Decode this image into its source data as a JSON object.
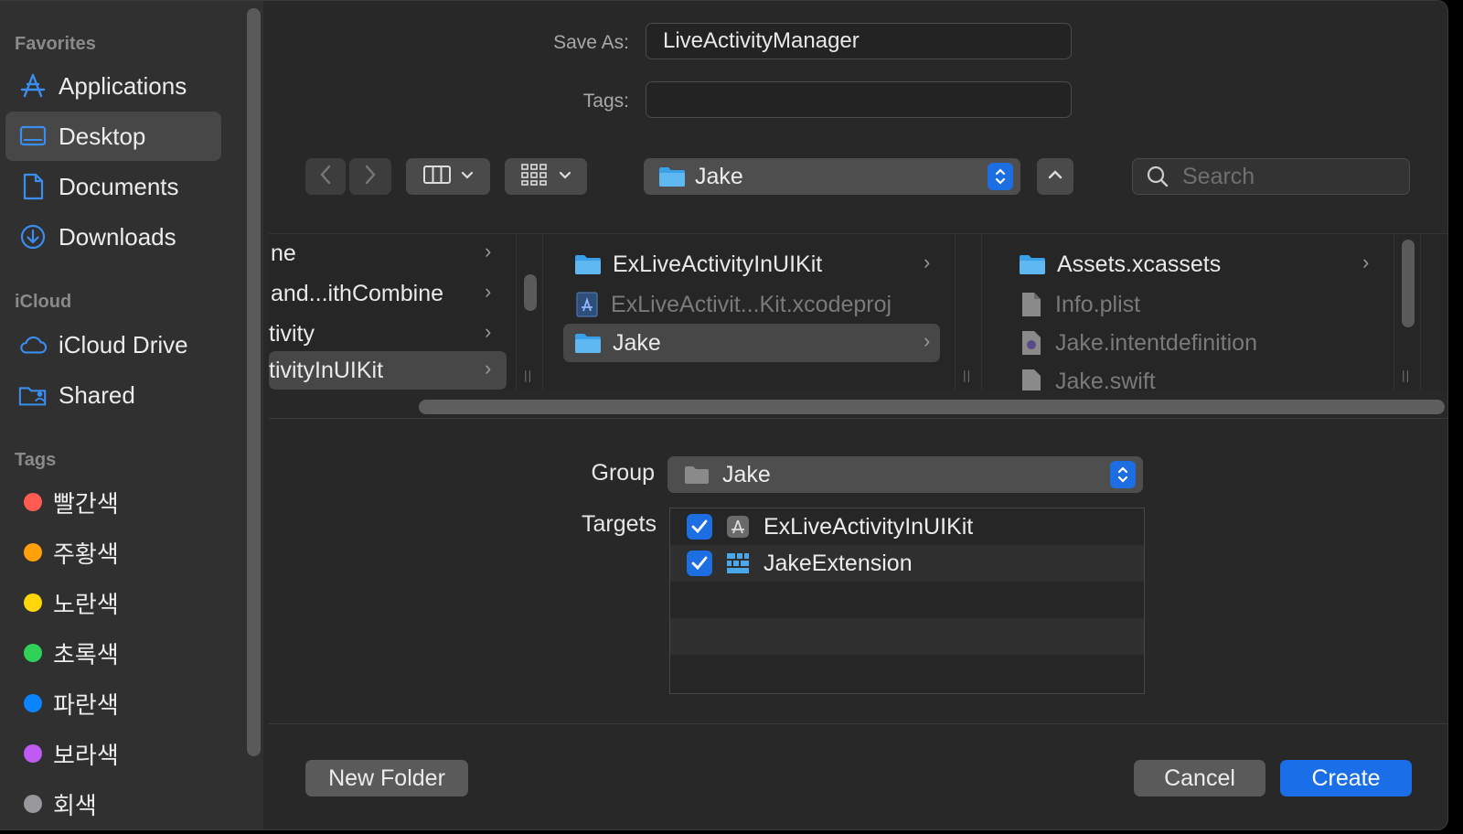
{
  "sidebar": {
    "sections": {
      "favorites": "Favorites",
      "icloud": "iCloud",
      "tags": "Tags"
    },
    "favorites": [
      {
        "label": "Applications",
        "icon": "applications-icon"
      },
      {
        "label": "Desktop",
        "icon": "desktop-icon",
        "selected": true
      },
      {
        "label": "Documents",
        "icon": "document-icon"
      },
      {
        "label": "Downloads",
        "icon": "download-icon"
      }
    ],
    "icloud": [
      {
        "label": "iCloud Drive",
        "icon": "cloud-icon"
      },
      {
        "label": "Shared",
        "icon": "shared-folder-icon"
      }
    ],
    "tags": [
      {
        "label": "빨간색",
        "color": "#ff5b52"
      },
      {
        "label": "주황색",
        "color": "#ff9f0a"
      },
      {
        "label": "노란색",
        "color": "#ffd60a"
      },
      {
        "label": "초록색",
        "color": "#30d158"
      },
      {
        "label": "파란색",
        "color": "#0a84ff"
      },
      {
        "label": "보라색",
        "color": "#bf5af2"
      },
      {
        "label": "회색",
        "color": "#98989d"
      }
    ]
  },
  "form": {
    "save_as_label": "Save As:",
    "save_as_value": "LiveActivityManager",
    "tags_label": "Tags:",
    "tags_value": ""
  },
  "toolbar": {
    "location": "Jake",
    "search_placeholder": "Search"
  },
  "browser": {
    "column1": [
      {
        "label": "ne"
      },
      {
        "label": "and...ithCombine"
      },
      {
        "label": "tivity"
      },
      {
        "label": "tivityInUIKit",
        "selected": true
      }
    ],
    "column2": [
      {
        "label": "ExLiveActivityInUIKit",
        "type": "folder"
      },
      {
        "label": "ExLiveActivit...Kit.xcodeproj",
        "type": "xcodeproj"
      },
      {
        "label": "Jake",
        "type": "folder",
        "selected": true
      }
    ],
    "column3": [
      {
        "label": "Assets.xcassets",
        "type": "folder"
      },
      {
        "label": "Info.plist",
        "type": "plist"
      },
      {
        "label": "Jake.intentdefinition",
        "type": "intent"
      },
      {
        "label": "Jake.swift",
        "type": "swift"
      }
    ]
  },
  "options": {
    "group_label": "Group",
    "group_value": "Jake",
    "targets_label": "Targets",
    "targets": [
      {
        "label": "ExLiveActivityInUIKit",
        "checked": true,
        "icon": "app-target-icon"
      },
      {
        "label": "JakeExtension",
        "checked": true,
        "icon": "extension-target-icon"
      }
    ]
  },
  "buttons": {
    "new_folder": "New Folder",
    "cancel": "Cancel",
    "create": "Create"
  },
  "colors": {
    "accent": "#1a6ee8",
    "folder": "#3aa0e8"
  }
}
